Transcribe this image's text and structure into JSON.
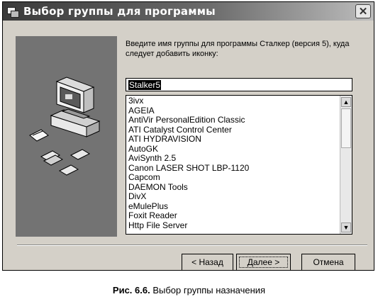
{
  "window": {
    "title": "Выбор группы для программы",
    "close_label": "✕"
  },
  "prompt_text": "Введите имя группы для программы Сталкер (версия 5), куда следует добавить иконку:",
  "group_input": {
    "value": "Stalker5"
  },
  "group_list": {
    "items": [
      "3ivx",
      "AGEIA",
      "AntiVir PersonalEdition Classic",
      "ATI Catalyst Control Center",
      "ATI HYDRAVISION",
      "AutoGK",
      "AviSynth 2.5",
      "Canon LASER SHOT LBP-1120",
      "Capcom",
      "DAEMON Tools",
      "DivX",
      "eMulePlus",
      "Foxit Reader",
      "Http File Server"
    ]
  },
  "buttons": {
    "back": "< Назад",
    "next": "Далее >",
    "cancel": "Отмена"
  },
  "caption": {
    "label": "Рис. 6.6.",
    "text": "Выбор группы назначения"
  },
  "icons": [
    "installer-icon",
    "close-icon",
    "computer-illustration",
    "scroll-up-icon",
    "scroll-down-icon"
  ]
}
